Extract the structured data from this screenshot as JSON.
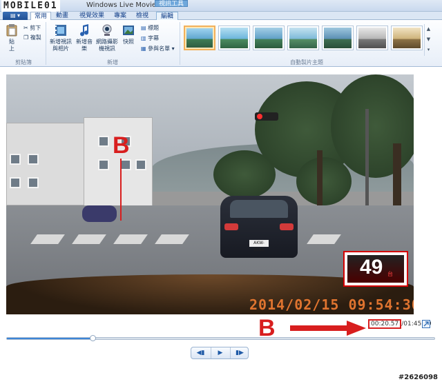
{
  "title_bar": {
    "watermark": "MOBILE01",
    "app_title": "Windows Live Movie Ma...",
    "contextual_label": "視訊工具"
  },
  "tabs": [
    {
      "label": "常用",
      "active": true
    },
    {
      "label": "動畫",
      "active": false
    },
    {
      "label": "視覺效果",
      "active": false
    },
    {
      "label": "專案",
      "active": false
    },
    {
      "label": "檢視",
      "active": false
    },
    {
      "label": "編輯",
      "active": false
    }
  ],
  "ribbon": {
    "clipboard": {
      "paste_label": "貼\n上",
      "cut_label": "剪下",
      "copy_label": "複製",
      "group_label": "剪貼簿"
    },
    "add": {
      "add_videos_label": "新增視訊與相片",
      "add_music_label": "新增音樂",
      "webcam_label": "網路攝影機視訊",
      "snapshot_label": "快照",
      "title_label": "標題",
      "caption_label": "字幕",
      "credits_label": "參與名單",
      "group_label": "新增"
    },
    "autothemes": {
      "group_label": "自動製片主題",
      "theme_count": 7,
      "selected_index": 0
    }
  },
  "video": {
    "timestamp_overlay": "2014/02/15  09:54:30",
    "plate": "AKW-9565",
    "channel_number": "49",
    "channel_sub": "台"
  },
  "annotations": {
    "marker_letter": "B"
  },
  "playback": {
    "current_time": "00:20.57",
    "separator": "/",
    "total_time": "01:45.00",
    "progress": 0.2,
    "prev_label": "◀▮",
    "play_label": "▶",
    "next_label": "▮▶"
  },
  "image_id": "#2626098",
  "colors": {
    "accent": "#3c85d6",
    "annotation_red": "#d81e1e",
    "overlay_orange": "#e0742f"
  }
}
